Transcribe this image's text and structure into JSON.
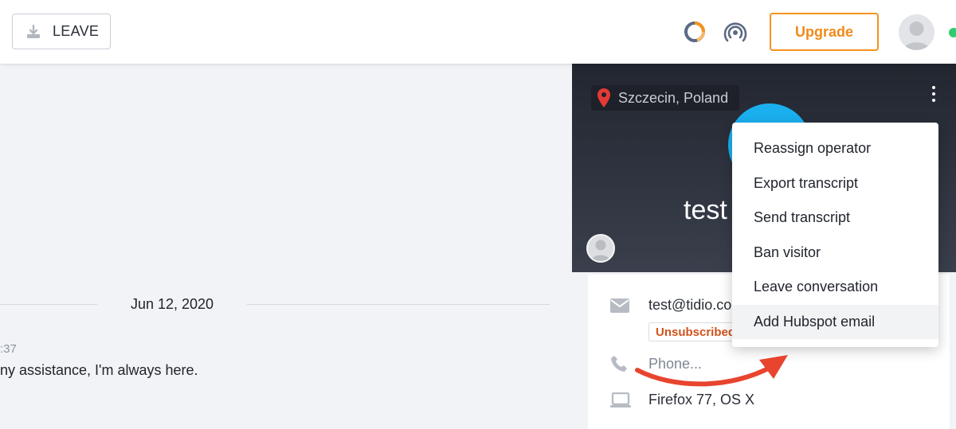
{
  "topbar": {
    "leave_label": "LEAVE",
    "upgrade_label": "Upgrade",
    "accent_color": "#f5921e"
  },
  "conversation": {
    "date_divider": "Jun 12, 2020",
    "message_time": ":37",
    "message_text": "ny assistance, I'm always here."
  },
  "visitor": {
    "location": "Szczecin, Poland",
    "name": "test",
    "email": "test@tidio.co",
    "email_status": "Unsubscribed",
    "phone_placeholder": "Phone...",
    "device": "Firefox 77, OS X",
    "avatar_color": "#1ab0f0"
  },
  "menu": {
    "items": [
      {
        "label": "Reassign operator"
      },
      {
        "label": "Export transcript"
      },
      {
        "label": "Send transcript"
      },
      {
        "label": "Ban visitor"
      },
      {
        "label": "Leave conversation"
      },
      {
        "label": "Add Hubspot email",
        "highlighted": true
      }
    ]
  },
  "annotation": {
    "arrow_color": "#e8442e"
  }
}
